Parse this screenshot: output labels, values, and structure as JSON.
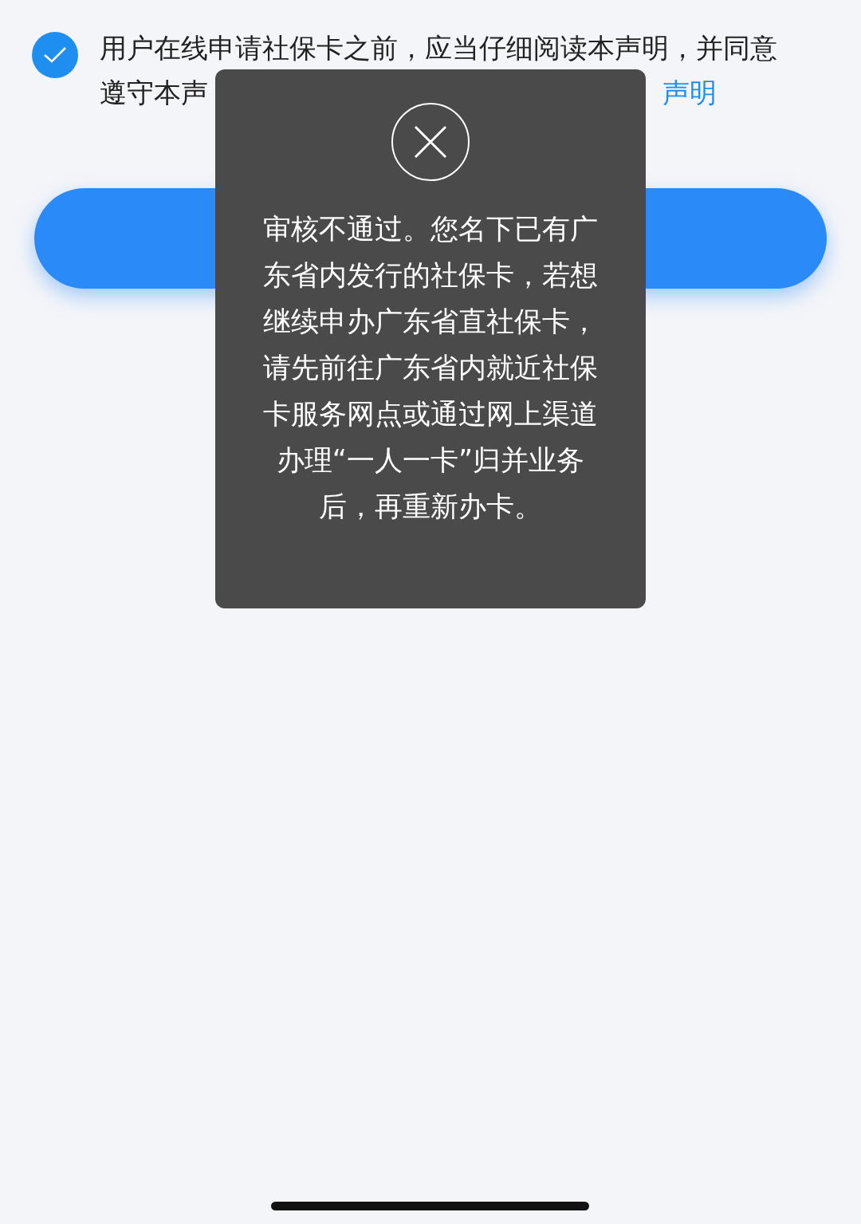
{
  "agreement": {
    "checked": true,
    "text_lines": [
      "用户在线申请社保卡之前，应当仔细阅读本声明，并同意",
      "遵守本声"
    ],
    "link": "声明"
  },
  "toast": {
    "message": "审核不通过。您名下已有广东省内发行的社保卡，若想继续申办广东省直社保卡，请先前往广东省内就近社保卡服务网点或通过网上渠道办理“一人一卡”归并业务后，再重新办卡。"
  }
}
